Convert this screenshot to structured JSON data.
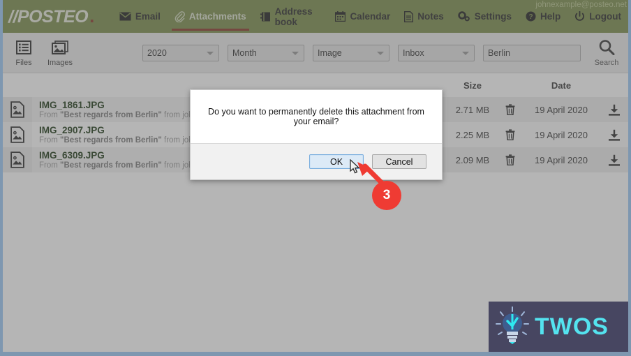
{
  "brand": {
    "name": "//POSTEO",
    "dot": "."
  },
  "header": {
    "user_email": "johnexample@posteo.net",
    "nav": [
      {
        "label": "Email",
        "icon": "envelope-icon",
        "active": false
      },
      {
        "label": "Attachments",
        "icon": "paperclip-icon",
        "active": true
      },
      {
        "label": "Address book",
        "icon": "address-book-icon",
        "active": false
      },
      {
        "label": "Calendar",
        "icon": "calendar-icon",
        "active": false
      },
      {
        "label": "Notes",
        "icon": "notes-icon",
        "active": false
      },
      {
        "label": "Settings",
        "icon": "gears-icon",
        "active": false
      },
      {
        "label": "Help",
        "icon": "question-circle-icon",
        "active": false
      },
      {
        "label": "Logout",
        "icon": "power-icon",
        "active": false
      }
    ]
  },
  "toolbar": {
    "view_buttons": [
      {
        "label": "Files",
        "icon": "list-icon"
      },
      {
        "label": "Images",
        "icon": "images-icon"
      }
    ],
    "filters": [
      {
        "name": "year",
        "value": "2020"
      },
      {
        "name": "month",
        "value": "Month"
      },
      {
        "name": "type",
        "value": "Image"
      },
      {
        "name": "folder",
        "value": "Inbox"
      }
    ],
    "search_value": "Berlin",
    "search_placeholder": "Search",
    "search_button_label": "Search",
    "search_icon": "magnifier-icon"
  },
  "table": {
    "columns": {
      "name": "",
      "size": "Size",
      "delete": "",
      "date": "Date",
      "download": ""
    },
    "rows": [
      {
        "icon": "image-file-icon",
        "filename": "IMG_1861.JPG",
        "from_prefix": "From",
        "subject": "\"Best regards from Berlin\"",
        "from_mid": "from",
        "sender": "johnexample@posteo.net",
        "size": "2.71 MB",
        "date": "19 April 2020",
        "delete_icon": "trash-icon",
        "download_icon": "download-icon"
      },
      {
        "icon": "image-file-icon",
        "filename": "IMG_2907.JPG",
        "from_prefix": "From",
        "subject": "\"Best regards from Berlin\"",
        "from_mid": "from",
        "sender": "johnexample@posteo.net",
        "size": "2.25 MB",
        "date": "19 April 2020",
        "delete_icon": "trash-icon",
        "download_icon": "download-icon"
      },
      {
        "icon": "image-file-icon",
        "filename": "IMG_6309.JPG",
        "from_prefix": "From",
        "subject": "\"Best regards from Berlin\"",
        "from_mid": "from",
        "sender": "johnexample@posteo.net",
        "size": "2.09 MB",
        "date": "19 April 2020",
        "delete_icon": "trash-icon",
        "download_icon": "download-icon"
      }
    ]
  },
  "dialog": {
    "message": "Do you want to permanently delete this attachment from your email?",
    "ok_label": "OK",
    "cancel_label": "Cancel"
  },
  "annotation": {
    "step_number": "3",
    "arrow_color": "#ef3b33"
  },
  "watermark": {
    "text": "TWOS",
    "icon": "lightbulb-icon"
  },
  "colors": {
    "brand_green": "#7d8f4e",
    "active_underline": "#8a3a2a",
    "accent_red": "#ef3b33",
    "watermark_bg": "#474661",
    "watermark_text": "#54e3ef"
  }
}
